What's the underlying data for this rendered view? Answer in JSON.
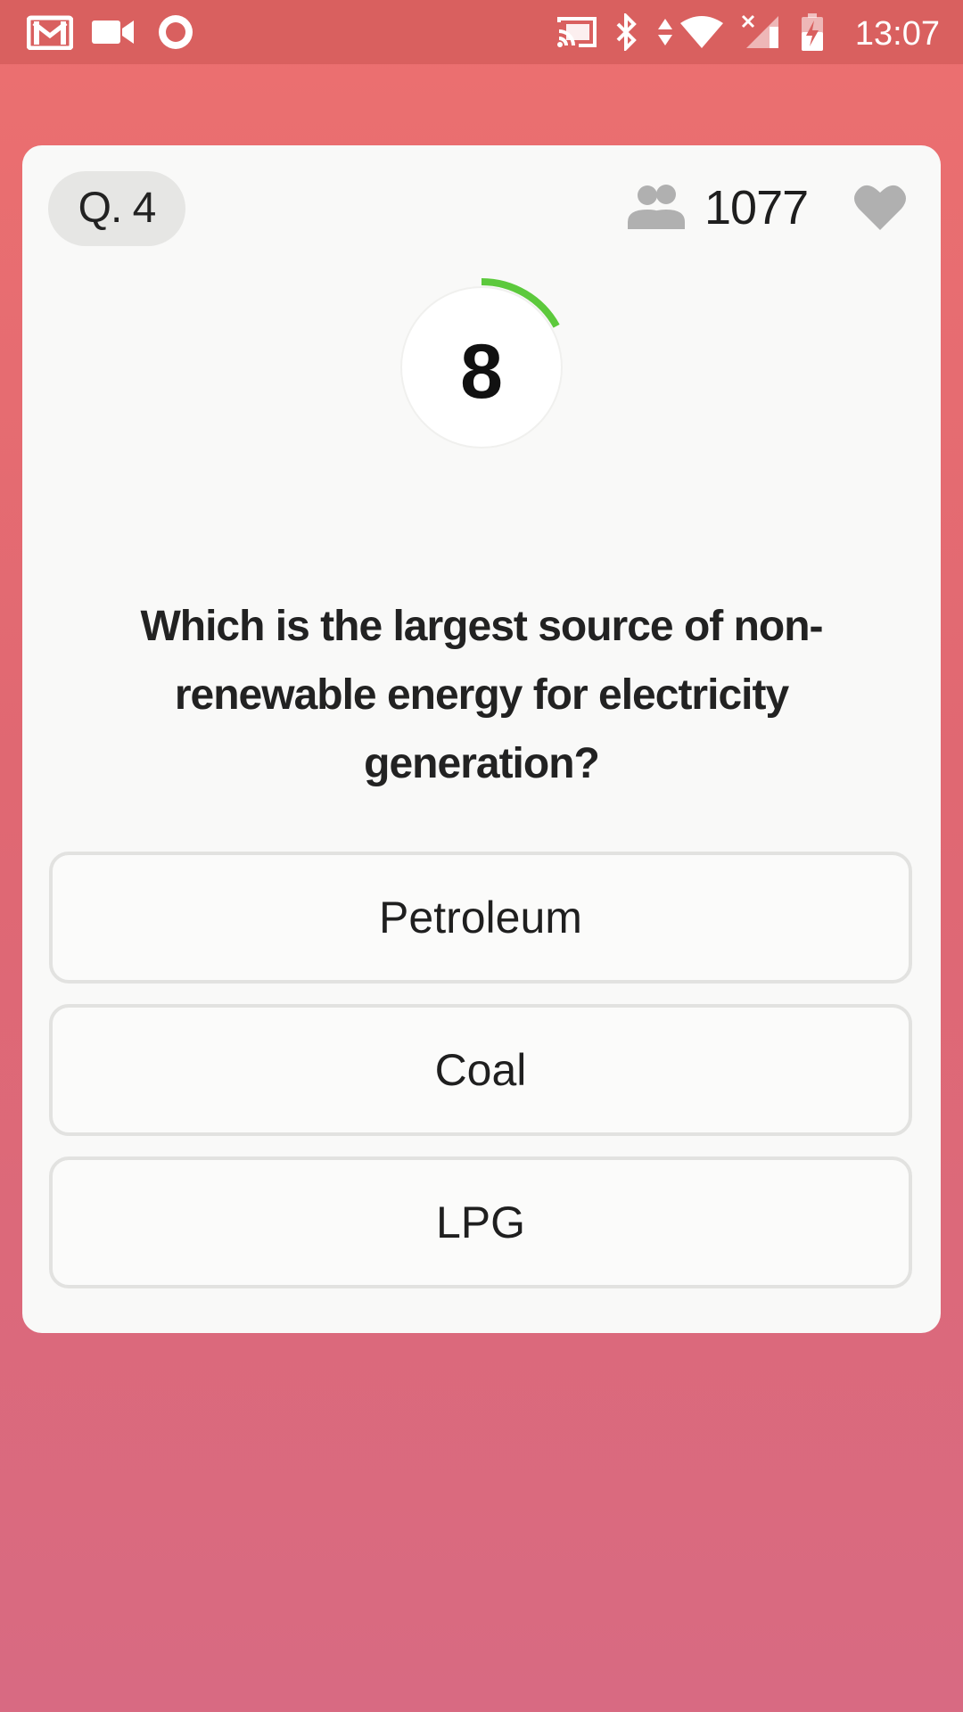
{
  "status_bar": {
    "time": "13:07",
    "icons": [
      "gmail-icon",
      "video-camera-icon",
      "record-icon",
      "cast-icon",
      "bluetooth-icon",
      "data-arrows-icon",
      "wifi-icon",
      "signal-no-service-icon",
      "battery-charging-icon"
    ]
  },
  "quiz": {
    "question_number": "Q. 4",
    "player_count": "1077",
    "timer_value": "8",
    "timer_progress": 0.17,
    "question": "Which is the largest source of non-renewable energy for electricity generation?",
    "options": [
      {
        "label": "Petroleum"
      },
      {
        "label": "Coal"
      },
      {
        "label": "LPG"
      }
    ]
  },
  "colors": {
    "background_top": "#ec7070",
    "background_bottom": "#d86a82",
    "status_bar": "#d9605f",
    "card": "#f9f9f8",
    "timer_arc": "#5cc93c",
    "icon_gray": "#b0b0b0"
  }
}
